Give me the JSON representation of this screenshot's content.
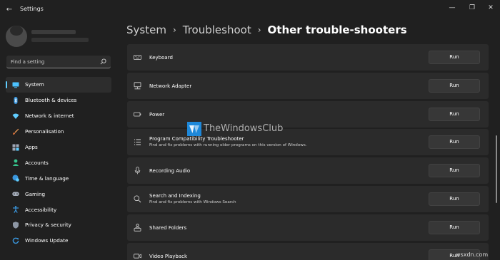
{
  "window": {
    "title": "Settings",
    "back_glyph": "←",
    "minimize_glyph": "—",
    "maximize_glyph": "❐",
    "close_glyph": "✕"
  },
  "search": {
    "placeholder": "Find a setting",
    "value": ""
  },
  "sidebar": {
    "items": [
      {
        "label": "System",
        "icon": "monitor-icon",
        "active": true
      },
      {
        "label": "Bluetooth & devices",
        "icon": "bluetooth-icon"
      },
      {
        "label": "Network & internet",
        "icon": "wifi-icon"
      },
      {
        "label": "Personalisation",
        "icon": "brush-icon"
      },
      {
        "label": "Apps",
        "icon": "apps-icon"
      },
      {
        "label": "Accounts",
        "icon": "person-icon"
      },
      {
        "label": "Time & language",
        "icon": "globe-clock-icon"
      },
      {
        "label": "Gaming",
        "icon": "gamepad-icon"
      },
      {
        "label": "Accessibility",
        "icon": "accessibility-icon"
      },
      {
        "label": "Privacy & security",
        "icon": "shield-icon"
      },
      {
        "label": "Windows Update",
        "icon": "update-icon"
      }
    ]
  },
  "breadcrumb": {
    "items": [
      "System",
      "Troubleshoot"
    ],
    "separator": "›",
    "current": "Other trouble-shooters"
  },
  "troubleshooters": [
    {
      "title": "Keyboard",
      "description": "",
      "icon": "keyboard-icon",
      "button": "Run"
    },
    {
      "title": "Network Adapter",
      "description": "",
      "icon": "network-adapter-icon",
      "button": "Run"
    },
    {
      "title": "Power",
      "description": "",
      "icon": "power-icon",
      "button": "Run"
    },
    {
      "title": "Program Compatibility Troubleshooter",
      "description": "Find and fix problems with running older programs on this version of Windows.",
      "icon": "list-icon",
      "button": "Run"
    },
    {
      "title": "Recording Audio",
      "description": "",
      "icon": "microphone-icon",
      "button": "Run"
    },
    {
      "title": "Search and Indexing",
      "description": "Find and fix problems with Windows Search",
      "icon": "search-icon",
      "button": "Run"
    },
    {
      "title": "Shared Folders",
      "description": "",
      "icon": "shared-folder-icon",
      "button": "Run"
    },
    {
      "title": "Video Playback",
      "description": "",
      "icon": "video-icon",
      "button": "Run"
    }
  ],
  "watermark": {
    "brand": "TheWindowsClub",
    "domain": "wsxdn.com"
  },
  "colors": {
    "background": "#202020",
    "card": "#2b2b2b",
    "button": "#373737",
    "accent": "#60cdff"
  }
}
